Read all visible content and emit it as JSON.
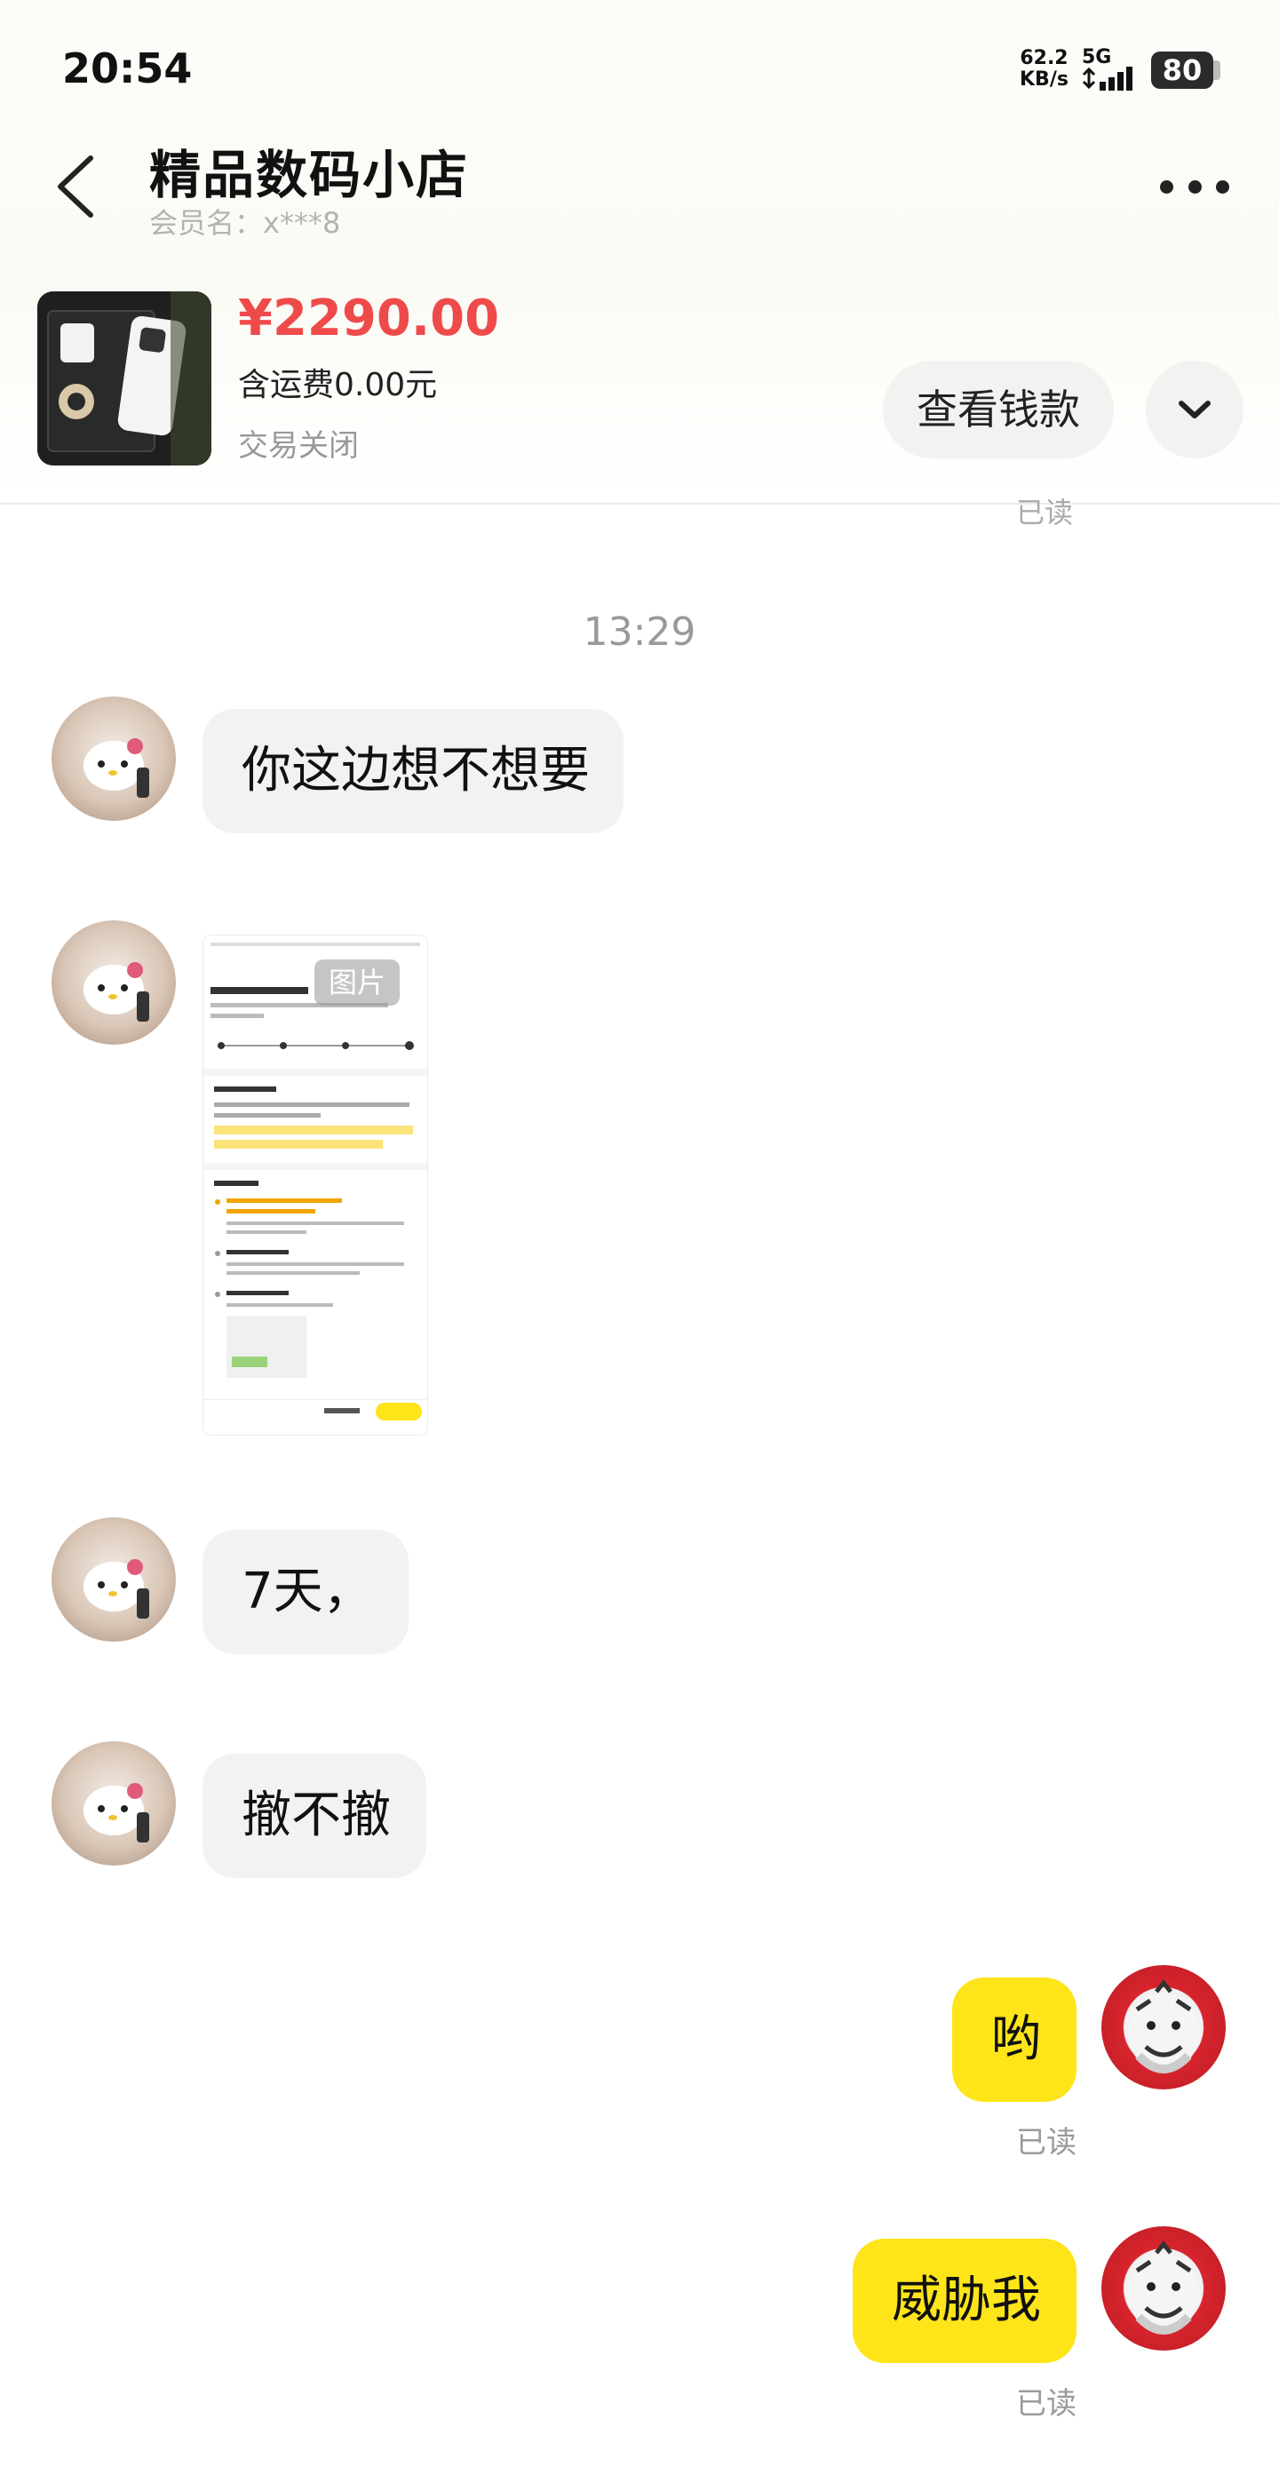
{
  "status_bar": {
    "time": "20:54",
    "net_speed_value": "62.2",
    "net_speed_unit": "KB/s",
    "network": "5G",
    "battery": "80"
  },
  "header": {
    "shop_name": "精品数码小店",
    "member": "会员名：x***8"
  },
  "product": {
    "price": "¥2290.00",
    "shipping": "含运费0.00元",
    "status": "交易关闭",
    "view_button": "查看钱款"
  },
  "chat": {
    "read_label": "已读",
    "timestamp": "13:29",
    "messages": [
      {
        "text": "你这边想不想要"
      },
      {
        "image_tag": "图片"
      },
      {
        "text": "7天，"
      },
      {
        "text": "撤不撤"
      },
      {
        "text": "哟"
      },
      {
        "text": "威胁我"
      }
    ]
  },
  "colors": {
    "price": "#ef4a4a",
    "outgoing_bubble": "#fde51a",
    "incoming_bubble": "#f2f2f4"
  },
  "icons": [
    "back-arrow-icon",
    "more-icon",
    "chevron-down-icon",
    "signal-icon",
    "battery-icon"
  ]
}
